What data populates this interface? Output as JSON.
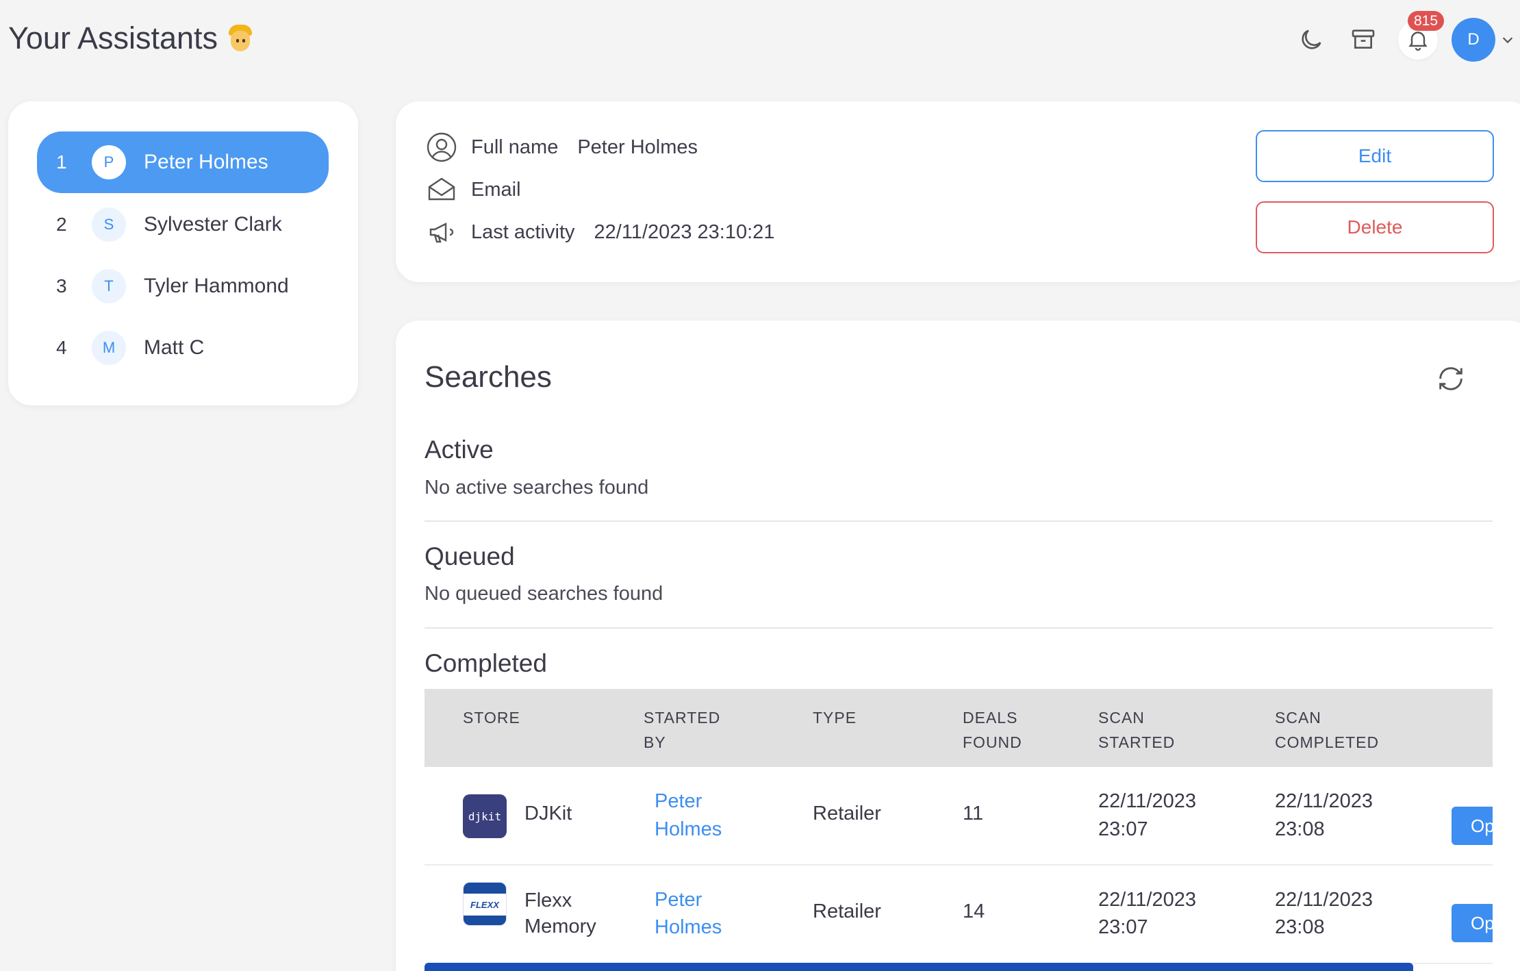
{
  "header": {
    "title": "Your Assistants",
    "notification_count": "815",
    "user_initial": "D"
  },
  "sidebar": {
    "items": [
      {
        "num": "1",
        "initial": "P",
        "name": "Peter Holmes",
        "active": true
      },
      {
        "num": "2",
        "initial": "S",
        "name": "Sylvester Clark",
        "active": false
      },
      {
        "num": "3",
        "initial": "T",
        "name": "Tyler Hammond",
        "active": false
      },
      {
        "num": "4",
        "initial": "M",
        "name": "Matt C",
        "active": false
      }
    ]
  },
  "profile": {
    "full_name_label": "Full name",
    "full_name_value": "Peter Holmes",
    "email_label": "Email",
    "email_value": "",
    "last_activity_label": "Last activity",
    "last_activity_value": "22/11/2023 23:10:21",
    "edit_label": "Edit",
    "delete_label": "Delete"
  },
  "searches": {
    "title": "Searches",
    "active": {
      "title": "Active",
      "message": "No active searches found"
    },
    "queued": {
      "title": "Queued",
      "message": "No queued searches found"
    },
    "completed": {
      "title": "Completed",
      "columns": [
        "STORE",
        "STARTED BY",
        "TYPE",
        "DEALS FOUND",
        "SCAN STARTED",
        "SCAN COMPLETED"
      ],
      "column_lines": [
        [
          "STORE"
        ],
        [
          "STARTED",
          "BY"
        ],
        [
          "TYPE"
        ],
        [
          "DEALS",
          "FOUND"
        ],
        [
          "SCAN",
          "STARTED"
        ],
        [
          "SCAN",
          "COMPLETED"
        ]
      ],
      "rows": [
        {
          "store": "DJKit",
          "store_lines": [
            "DJKit"
          ],
          "logo": "djkit",
          "started_by_lines": [
            "Peter",
            "Holmes"
          ],
          "type": "Retailer",
          "deals": "11",
          "scan_started_lines": [
            "22/11/2023",
            "23:07"
          ],
          "scan_completed_lines": [
            "22/11/2023",
            "23:08"
          ],
          "open_label": "Open"
        },
        {
          "store": "Flexx Memory",
          "store_lines": [
            "Flexx",
            "Memory"
          ],
          "logo": "flexx",
          "started_by_lines": [
            "Peter",
            "Holmes"
          ],
          "type": "Retailer",
          "deals": "14",
          "scan_started_lines": [
            "22/11/2023",
            "23:07"
          ],
          "scan_completed_lines": [
            "22/11/2023",
            "23:08"
          ],
          "open_label": "Open"
        }
      ]
    }
  },
  "logos": {
    "djkit_text": "djkit",
    "flexx_text": "FLEXX"
  },
  "colors": {
    "accent": "#3d8ef0",
    "active_item": "#4c9af2",
    "danger": "#e05a5a",
    "badge": "#e05252"
  },
  "icons": [
    "moon-icon",
    "archive-icon",
    "bell-icon",
    "chevron-down-icon",
    "user-circle-icon",
    "envelope-icon",
    "megaphone-icon",
    "refresh-icon"
  ]
}
